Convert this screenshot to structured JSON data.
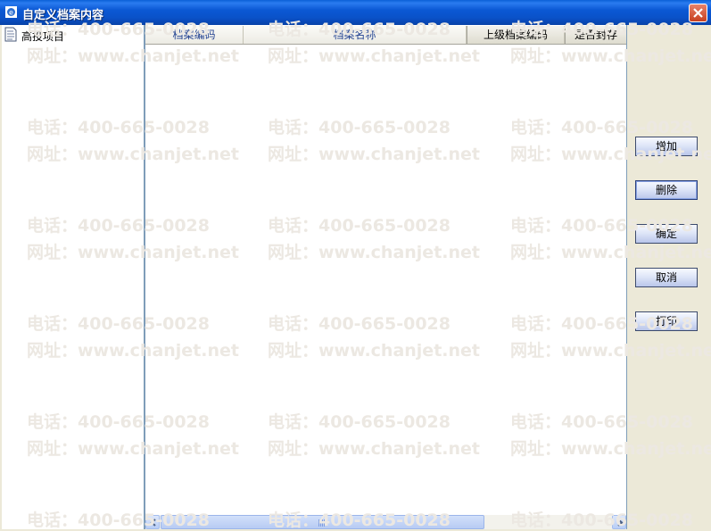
{
  "window": {
    "title": "自定义档案内容",
    "icon": "app-icon"
  },
  "tree": {
    "items": [
      {
        "label": "高投项目",
        "icon": "document-icon"
      }
    ]
  },
  "grid": {
    "columns": [
      "档案编码",
      "档案名称",
      "上级档案编码",
      "是否封存"
    ],
    "rows": []
  },
  "buttons": {
    "add": "增加",
    "delete": "删除",
    "confirm": "确定",
    "cancel": "取消",
    "print": "打印"
  },
  "watermark": {
    "phone": "电话：400-665-0028",
    "site": "网址：www.chanjet.net"
  },
  "colors": {
    "titlebar": "#0a52c9",
    "header_text": "#1f3f8f",
    "window_bg": "#ece9d8"
  }
}
